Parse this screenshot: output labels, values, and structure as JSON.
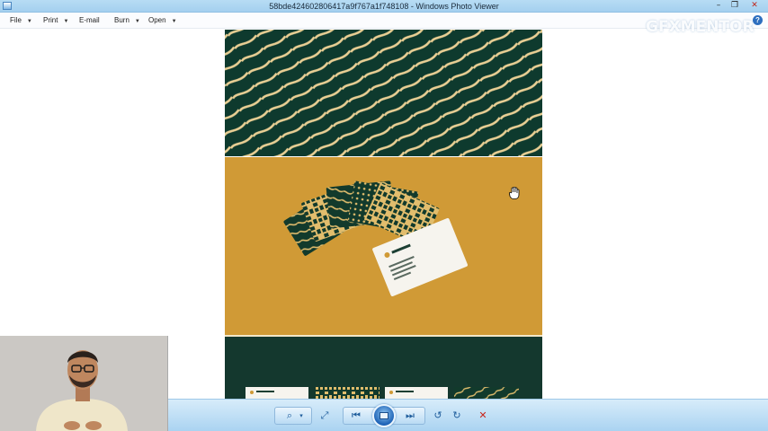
{
  "window": {
    "title": "58bde424602806417a9f767a1f748108 - Windows Photo Viewer",
    "min_glyph": "–",
    "restore_glyph": "❐",
    "close_glyph": "✕"
  },
  "menu": {
    "items": [
      "File",
      "Print",
      "E-mail",
      "Burn",
      "Open"
    ],
    "help_glyph": "?"
  },
  "watermark": "GFXMENTOR",
  "toolbar": {
    "zoom_glyph": "⌕",
    "fit_glyph": "⤢",
    "prev_glyph": "⏮",
    "next_glyph": "⏭",
    "rotate_ccw_glyph": "↺",
    "rotate_cw_glyph": "↻",
    "delete_glyph": "✕"
  },
  "colors": {
    "pattern_bg": "#0e3a2e",
    "pattern_stripe": "#e9cf94",
    "mustard": "#d09a36",
    "dark_green": "#14382e"
  },
  "icons": [
    "zoom-icon",
    "fit-window-icon",
    "previous-icon",
    "slideshow-icon",
    "next-icon",
    "rotate-counterclockwise-icon",
    "rotate-clockwise-icon",
    "delete-icon",
    "hand-cursor-icon"
  ]
}
